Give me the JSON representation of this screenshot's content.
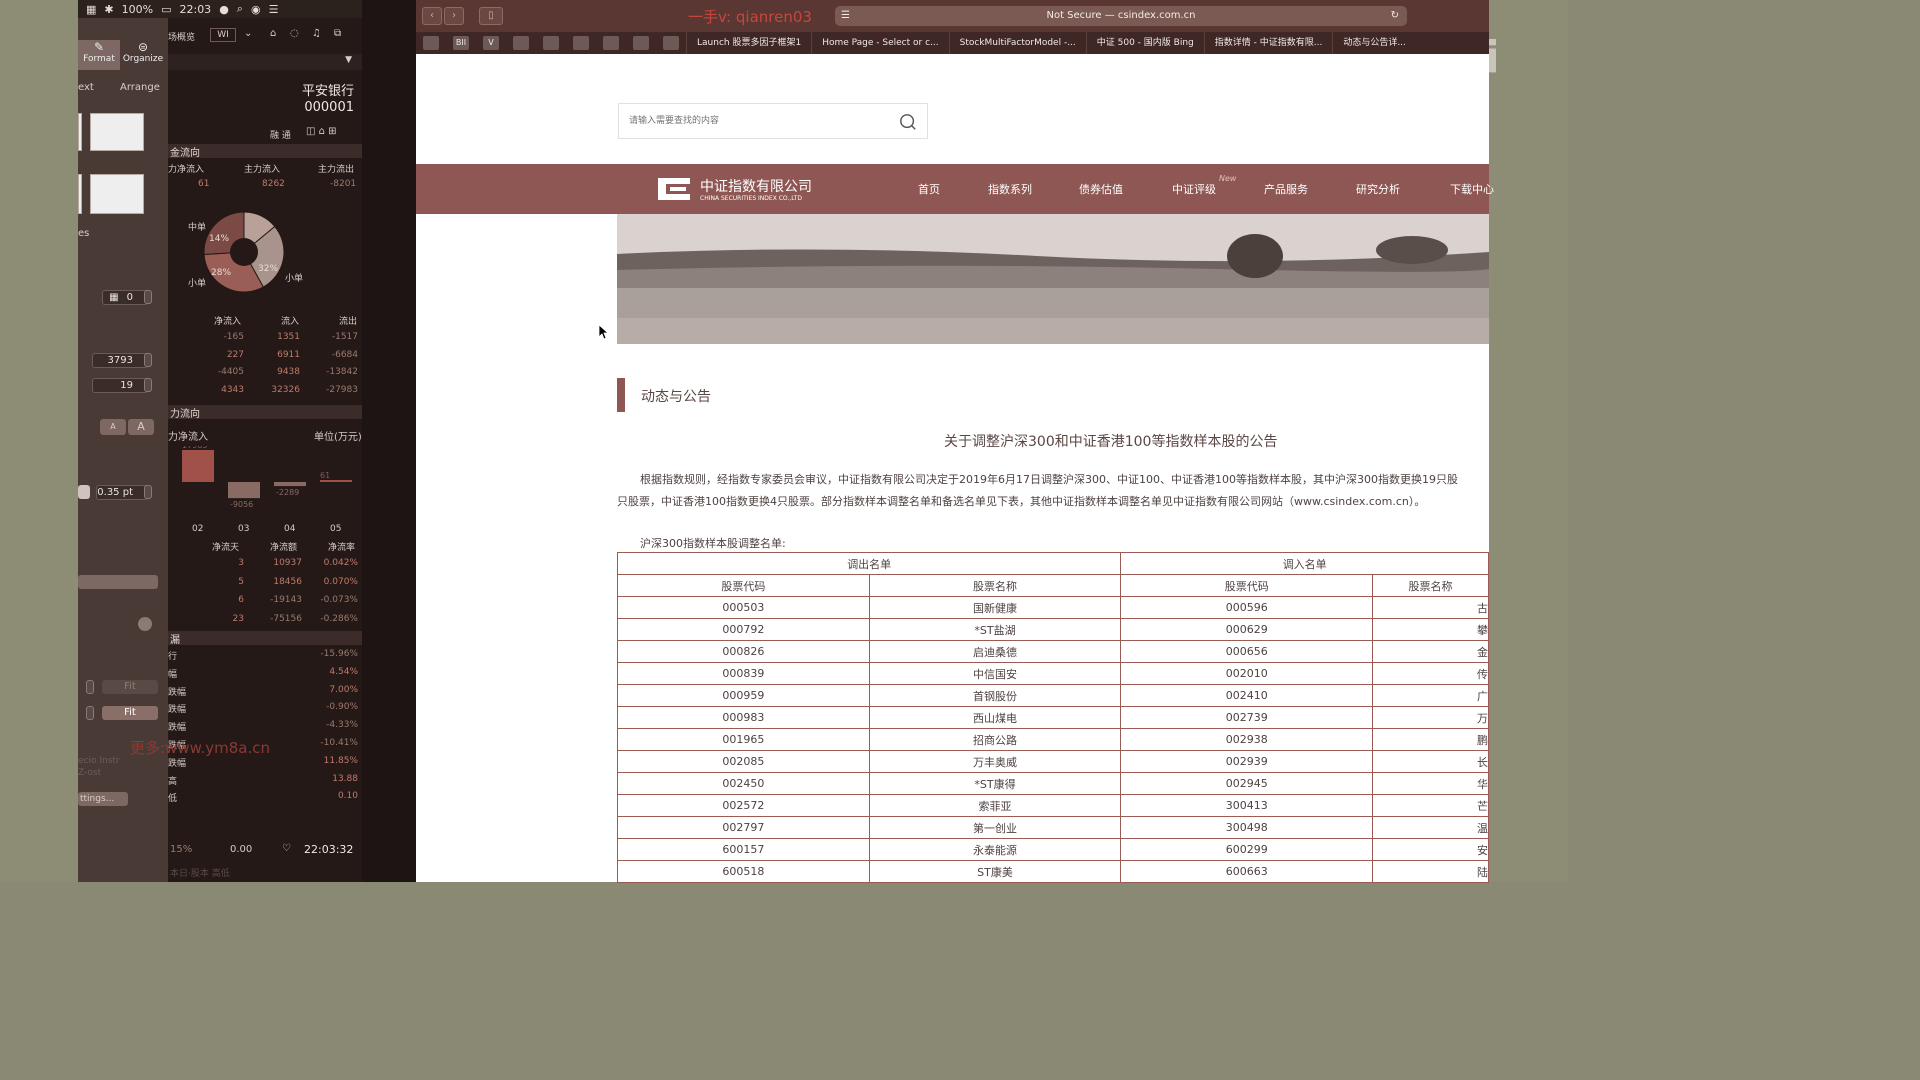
{
  "menubar": {
    "battery": "100%",
    "time": "22:03"
  },
  "inspector": {
    "tabs": [
      "Format",
      "Organize"
    ],
    "subtabs": [
      "ext",
      "Arrange"
    ],
    "side_label": "es",
    "field1": "0",
    "field2": "3793",
    "field3": "19",
    "font_small": "A",
    "font_large": "A",
    "stroke": "0.35 pt",
    "fit1": "Fit",
    "fit2": "Fit",
    "faded1": "ecio Instr",
    "faded2": "Z-ost",
    "settings": "ttings..."
  },
  "stock": {
    "toolbar_label": "场概览",
    "toolbar_field": "WI",
    "toolbar_icons": "融 通",
    "name": "平安银行",
    "code": "000001",
    "flow_header": "金流向",
    "flow_cols": [
      "力净流入",
      "主力流入",
      "主力流出"
    ],
    "flow_vals": [
      "61",
      "8262",
      "-8201"
    ],
    "pie": {
      "labels": [
        "中单",
        "小单",
        "小单"
      ],
      "percents": [
        "14%",
        "28%",
        "32%"
      ]
    },
    "table_cols": [
      "净流入",
      "流入",
      "流出"
    ],
    "table_rows": [
      [
        "-165",
        "1351",
        "-1517"
      ],
      [
        "227",
        "6911",
        "-6684"
      ],
      [
        "-4405",
        "9438",
        "-13842"
      ],
      [
        "4343",
        "32326",
        "-27983"
      ]
    ],
    "section2": "力流向",
    "net_label": "力净流入",
    "unit": "单位(万元)",
    "bar_values": [
      "17965",
      "-9056",
      "-2289",
      "61"
    ],
    "bar_days": [
      "02",
      "03",
      "04",
      "05"
    ],
    "stats_cols": [
      "净流天",
      "净流额",
      "净流率"
    ],
    "stats_rows": [
      [
        "3",
        "10937",
        "0.042%"
      ],
      [
        "5",
        "18456",
        "0.070%"
      ],
      [
        "6",
        "-19143",
        "-0.073%"
      ],
      [
        "23",
        "-75156",
        "-0.286%"
      ]
    ],
    "section3": "漏",
    "metrics": [
      {
        "label": "行",
        "value": "-15.96%"
      },
      {
        "label": "幅",
        "value": "4.54%"
      },
      {
        "label": "跌幅",
        "value": "7.00%"
      },
      {
        "label": "跌幅",
        "value": "-0.90%"
      },
      {
        "label": "跌幅",
        "value": "-4.33%"
      },
      {
        "label": "跌幅",
        "value": "-10.41%"
      },
      {
        "label": "跌幅",
        "value": "11.85%"
      },
      {
        "label": "高",
        "value": "13.88"
      },
      {
        "label": "低",
        "value": "0.10"
      }
    ],
    "footer_pct": "15%",
    "footer_val": "0.00",
    "footer_time": "22:03:32",
    "footer_faded": "本日·股本 高低"
  },
  "watermark_site": "更多:www.ym8a.cn",
  "browser": {
    "watermark_user": "一手v: qianren03",
    "url": "Not Secure — csindex.com.cn",
    "tabs": [
      "Launch 股票多因子框架1",
      "Home Page - Select or c...",
      "StockMultiFactorModel -...",
      "中证 500 - 国内版 Bing",
      "指数详情 - 中证指数有限...",
      "动态与公告详..."
    ],
    "fav_labels": [
      "",
      "BII",
      "V",
      "",
      "",
      "",
      "",
      "",
      ""
    ],
    "search_placeholder": "请输入需要查找的内容",
    "logo_cn": "中证指数有限公司",
    "logo_en": "CHINA SECURITIES INDEX CO.,LTD",
    "nav": [
      "首页",
      "指数系列",
      "债券估值",
      "中证评级",
      "产品服务",
      "研究分析",
      "下载中心"
    ],
    "new_badge": "New",
    "section_title": "动态与公告",
    "article_title": "关于调整沪深300和中证香港100等指数样本股的公告",
    "para1": "根据指数规则，经指数专家委员会审议，中证指数有限公司决定于2019年6月17日调整沪深300、中证100、中证香港100等指数样本股，其中沪深300指数更换19只股",
    "para2": "只股票，中证香港100指数更换4只股票。部分指数样本调整名单和备选名单见下表，其他中证指数样本调整名单见中证指数有限公司网站（www.csindex.com.cn）。",
    "table_caption": "沪深300指数样本股调整名单:",
    "table_groups": [
      "调出名单",
      "调入名单"
    ],
    "table_cols": [
      "股票代码",
      "股票名称",
      "股票代码",
      "股票名称"
    ],
    "table_rows": [
      [
        "000503",
        "国新健康",
        "000596",
        "古"
      ],
      [
        "000792",
        "*ST盐湖",
        "000629",
        "攀"
      ],
      [
        "000826",
        "启迪桑德",
        "000656",
        "金"
      ],
      [
        "000839",
        "中信国安",
        "002010",
        "传"
      ],
      [
        "000959",
        "首钢股份",
        "002410",
        "广"
      ],
      [
        "000983",
        "西山煤电",
        "002739",
        "万"
      ],
      [
        "001965",
        "招商公路",
        "002938",
        "鹏"
      ],
      [
        "002085",
        "万丰奥威",
        "002939",
        "长"
      ],
      [
        "002450",
        "*ST康得",
        "002945",
        "华"
      ],
      [
        "002572",
        "索菲亚",
        "300413",
        "芒"
      ],
      [
        "002797",
        "第一创业",
        "300498",
        "温"
      ],
      [
        "600157",
        "永泰能源",
        "600299",
        "安"
      ],
      [
        "600518",
        "ST康美",
        "600663",
        "陆"
      ]
    ]
  },
  "bili": "bili"
}
